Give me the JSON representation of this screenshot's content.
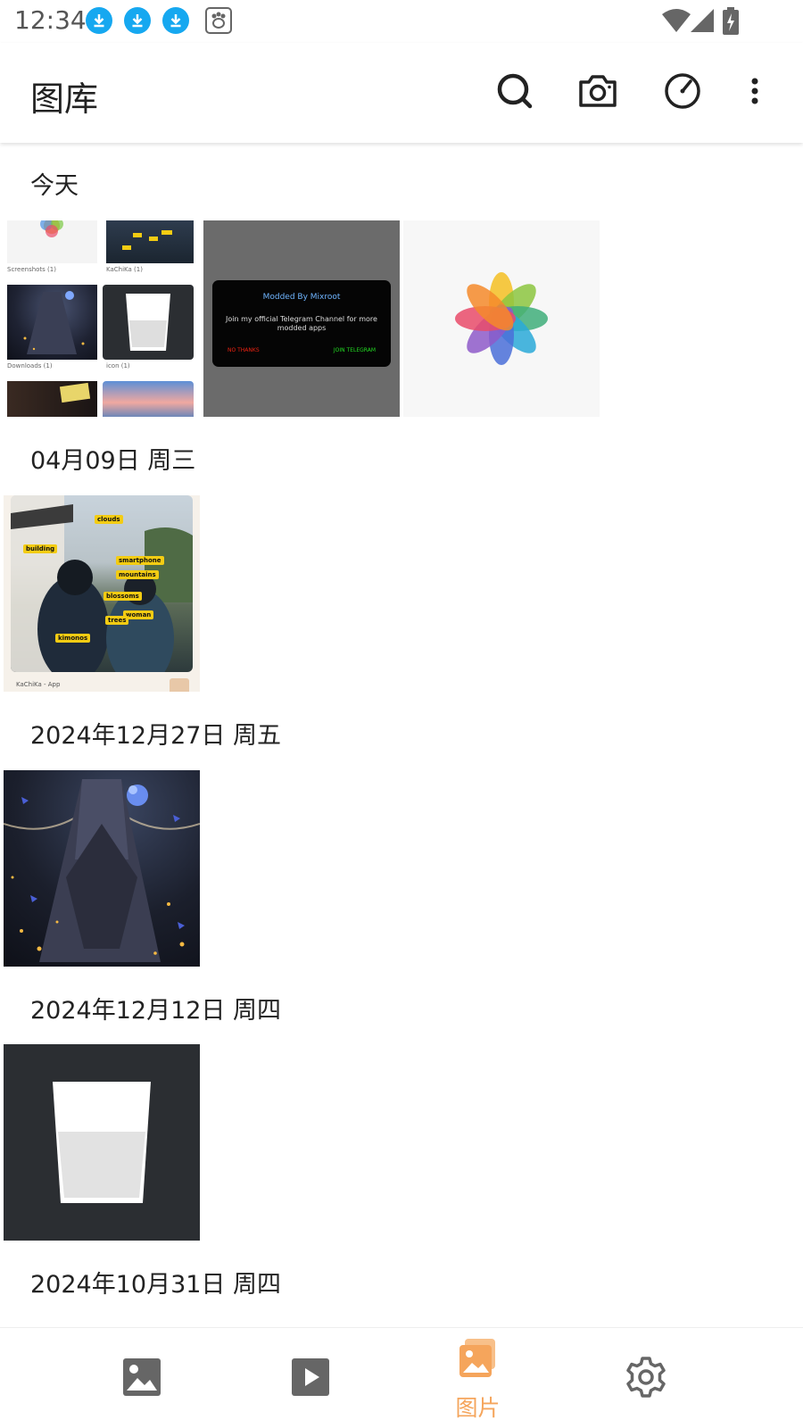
{
  "status_bar": {
    "time": "12:34",
    "notification_icons": [
      "download-icon",
      "download-icon",
      "download-icon",
      "baidu-paw-icon"
    ],
    "right_icons": [
      "wifi-icon",
      "signal-icon",
      "battery-charging-icon"
    ]
  },
  "app_bar": {
    "title": "图库",
    "actions": [
      "search-icon",
      "camera-icon",
      "timer-icon",
      "more-vert-icon"
    ]
  },
  "sections": [
    {
      "date": "今天",
      "items": [
        {
          "kind": "album-collage",
          "albums": [
            {
              "caption": "Screenshots (1)"
            },
            {
              "caption": "KaChiKa (1)"
            },
            {
              "caption": "Downloads (1)"
            },
            {
              "caption": "icon (1)"
            }
          ]
        },
        {
          "kind": "mod-dialog",
          "title": "Modded By Mixroot",
          "body": "Join my official Telegram Channel for more modded apps",
          "btn_no": "NO THANKS",
          "btn_join": "JOIN TELEGRAM"
        },
        {
          "kind": "photos-pinwheel"
        }
      ]
    },
    {
      "date": "04月09日 周三",
      "items": [
        {
          "kind": "kachika",
          "tags": [
            "clouds",
            "building",
            "smartphone",
            "mountains",
            "blossoms",
            "woman",
            "trees",
            "kimonos"
          ],
          "caption": "KaChiKa - App"
        }
      ]
    },
    {
      "date": "2024年12月27日 周五",
      "items": [
        {
          "kind": "anime-art"
        }
      ]
    },
    {
      "date": "2024年12月12日 周四",
      "items": [
        {
          "kind": "glass-icon"
        }
      ]
    },
    {
      "date": "2024年10月31日 周四",
      "items": []
    }
  ],
  "bottom_nav": {
    "items": [
      {
        "icon": "image-icon",
        "label": "",
        "active": false
      },
      {
        "icon": "video-play-icon",
        "label": "",
        "active": false
      },
      {
        "icon": "albums-icon",
        "label": "图片",
        "active": true
      },
      {
        "icon": "gear-icon",
        "label": "",
        "active": false
      }
    ],
    "active_color": "#f5a55c",
    "inactive_color": "#777777"
  },
  "colors": {
    "download_badge": "#16a8f0",
    "accent": "#f5a55c"
  }
}
